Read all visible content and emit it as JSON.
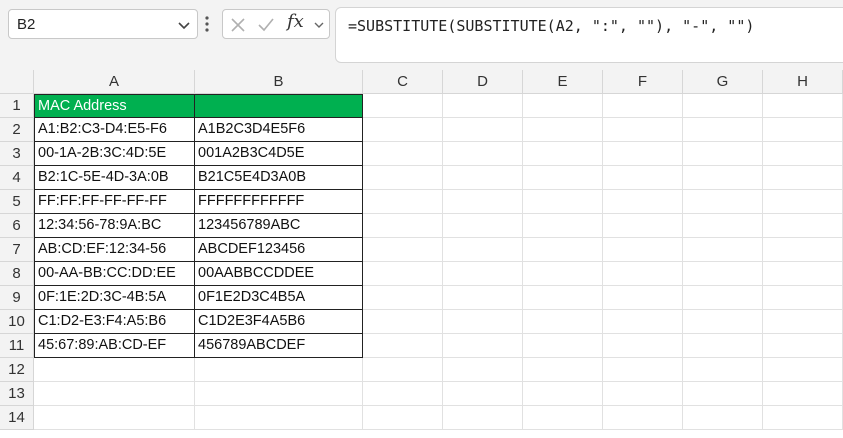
{
  "name_box": {
    "value": "B2"
  },
  "formula_bar": {
    "fx_label": "fx",
    "formula": "=SUBSTITUTE(SUBSTITUTE(A2, \":\", \"\"), \"-\", \"\")"
  },
  "colors": {
    "header_fill": "#00b050",
    "header_text": "#ffffff"
  },
  "columns": [
    "A",
    "B",
    "C",
    "D",
    "E",
    "F",
    "G",
    "H"
  ],
  "rows": [
    "1",
    "2",
    "3",
    "4",
    "5",
    "6",
    "7",
    "8",
    "9",
    "10",
    "11",
    "12",
    "13",
    "14"
  ],
  "table": {
    "header": [
      "MAC Address",
      ""
    ],
    "data": [
      [
        "A1:B2:C3-D4:E5-F6",
        "A1B2C3D4E5F6"
      ],
      [
        "00-1A-2B:3C:4D:5E",
        "001A2B3C4D5E"
      ],
      [
        "B2:1C-5E-4D-3A:0B",
        "B21C5E4D3A0B"
      ],
      [
        "FF:FF:FF-FF-FF-FF",
        "FFFFFFFFFFFF"
      ],
      [
        "12:34:56-78:9A:BC",
        "123456789ABC"
      ],
      [
        "AB:CD:EF:12:34-56",
        "ABCDEF123456"
      ],
      [
        "00-AA-BB:CC:DD:EE",
        "00AABBCCDDEE"
      ],
      [
        "0F:1E:2D:3C-4B:5A",
        "0F1E2D3C4B5A"
      ],
      [
        "C1:D2-E3:F4:A5:B6",
        "C1D2E3F4A5B6"
      ],
      [
        "45:67:89:AB:CD-EF",
        "456789ABCDEF"
      ]
    ]
  }
}
